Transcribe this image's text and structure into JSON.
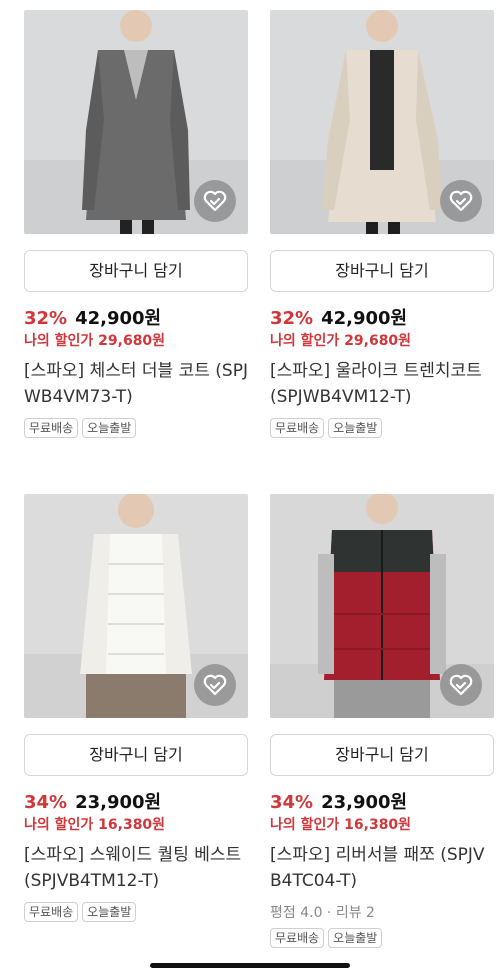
{
  "products": [
    {
      "cart_label": "장바구니 담기",
      "discount": "32%",
      "price": "42,900원",
      "my_discount": "나의 할인가 29,680원",
      "title": "[스파오] 체스터 더블 코트 (SPJWB4VM73-T)",
      "rating": "",
      "tags": [
        "무료배송",
        "오늘출발"
      ],
      "icon": "heart-check-icon"
    },
    {
      "cart_label": "장바구니 담기",
      "discount": "32%",
      "price": "42,900원",
      "my_discount": "나의 할인가 29,680원",
      "title": "[스파오] 울라이크 트렌치코트 (SPJWB4VM12-T)",
      "rating": "",
      "tags": [
        "무료배송",
        "오늘출발"
      ],
      "icon": "heart-check-icon"
    },
    {
      "cart_label": "장바구니 담기",
      "discount": "34%",
      "price": "23,900원",
      "my_discount": "나의 할인가 16,380원",
      "title": "[스파오] 스웨이드 퀄팅 베스트 (SPJVB4TM12-T)",
      "rating": "",
      "tags": [
        "무료배송",
        "오늘출발"
      ],
      "icon": "heart-check-icon"
    },
    {
      "cart_label": "장바구니 담기",
      "discount": "34%",
      "price": "23,900원",
      "my_discount": "나의 할인가 16,380원",
      "title": "[스파오] 리버서블 패쪼 (SPJVB4TC04-T)",
      "rating": "평점 4.0 · 리뷰 2",
      "tags": [
        "무료배송",
        "오늘출발"
      ],
      "icon": "heart-check-icon"
    }
  ],
  "colors": {
    "discount_red": "#d0363a",
    "border_gray": "#d6d6d6"
  }
}
